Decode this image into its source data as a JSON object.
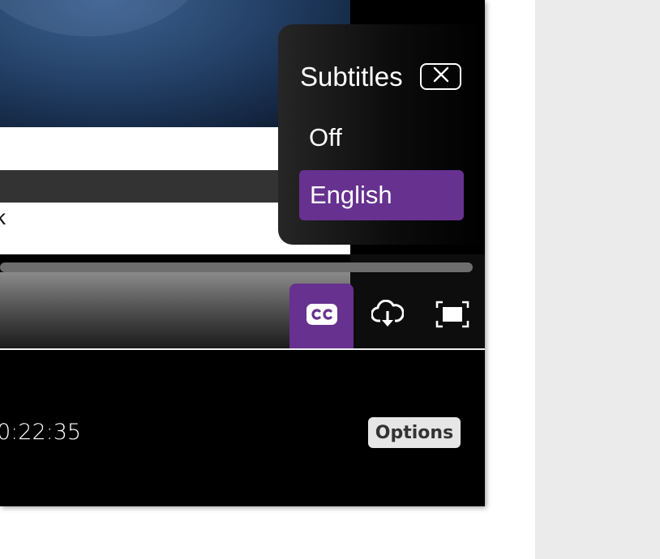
{
  "colors": {
    "accent": "#66318f",
    "player_background": "#000000",
    "side_panel": "#ebebeb",
    "options_button": "#e6e6e6"
  },
  "slide": {
    "partial_text": "k"
  },
  "player": {
    "timestamp": "0:22:35",
    "options_label": "Options",
    "controls": [
      {
        "name": "closed-captions",
        "icon": "cc-icon",
        "active": true
      },
      {
        "name": "download",
        "icon": "cloud-download-icon",
        "active": false
      },
      {
        "name": "fullscreen",
        "icon": "fullscreen-icon",
        "active": false
      }
    ]
  },
  "subtitles_menu": {
    "title": "Subtitles",
    "close_icon": "close-icon",
    "options": [
      {
        "label": "Off",
        "selected": false
      },
      {
        "label": "English",
        "selected": true
      }
    ]
  }
}
